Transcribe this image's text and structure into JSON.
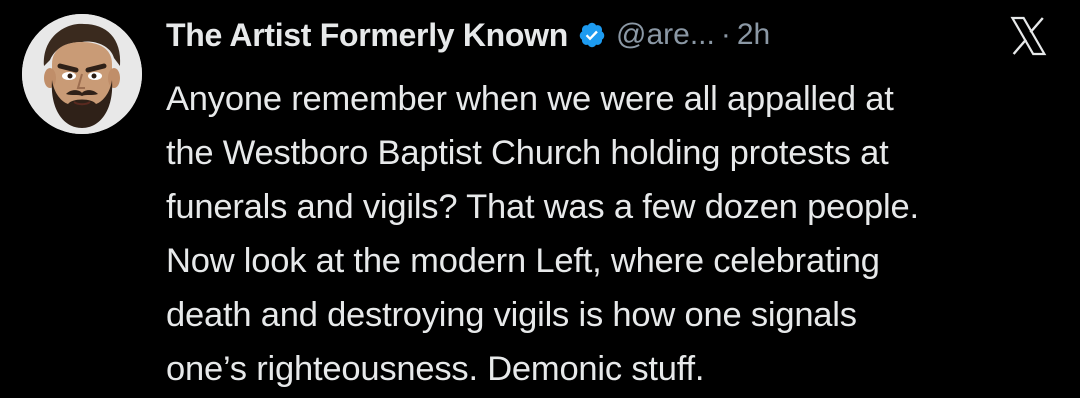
{
  "tweet": {
    "author": {
      "display_name": "The Artist Formerly Known",
      "handle": "@are...",
      "verified": true,
      "avatar_icon": "cartoon-bearded-man-avatar"
    },
    "separator": "·",
    "timestamp": "2h",
    "platform_icon": "x-logo-icon",
    "text_lines": [
      "Anyone remember when we were all appalled at",
      "the Westboro Baptist Church holding protests at",
      "funerals and vigils? That was a few dozen people.",
      "Now look at the modern Left, where celebrating",
      "death and destroying vigils is how one signals",
      "one’s righteousness. Demonic stuff."
    ]
  },
  "colors": {
    "background": "#000000",
    "text_primary": "#e7e9ea",
    "text_secondary": "#8b98a5",
    "verified_blue": "#1d9bf0"
  }
}
